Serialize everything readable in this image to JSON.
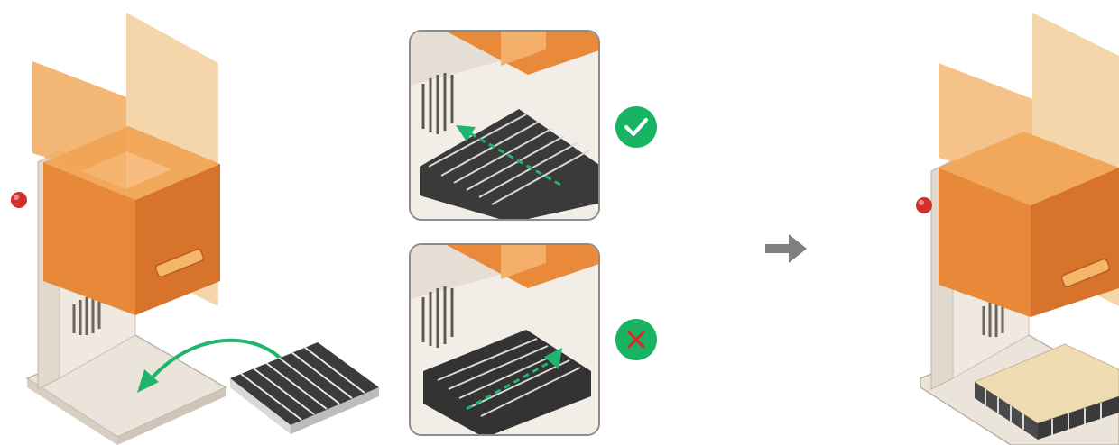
{
  "colors": {
    "accent_green": "#1fb56c",
    "check_green": "#19b364",
    "cross_red": "#e02424",
    "amber_shield": "#ef9a3c",
    "amber_shield_light": "#f6c68a",
    "metal_frame": "#e8e1d8",
    "panel_border": "#8c8c8c",
    "next_arrow": "#7f7f7f",
    "honeycomb_top": "#efdcb2"
  },
  "icons": {
    "correct": "check-circle-icon",
    "wrong": "cross-circle-icon",
    "next": "arrow-right-icon",
    "move": "curved-arrow-icon"
  }
}
